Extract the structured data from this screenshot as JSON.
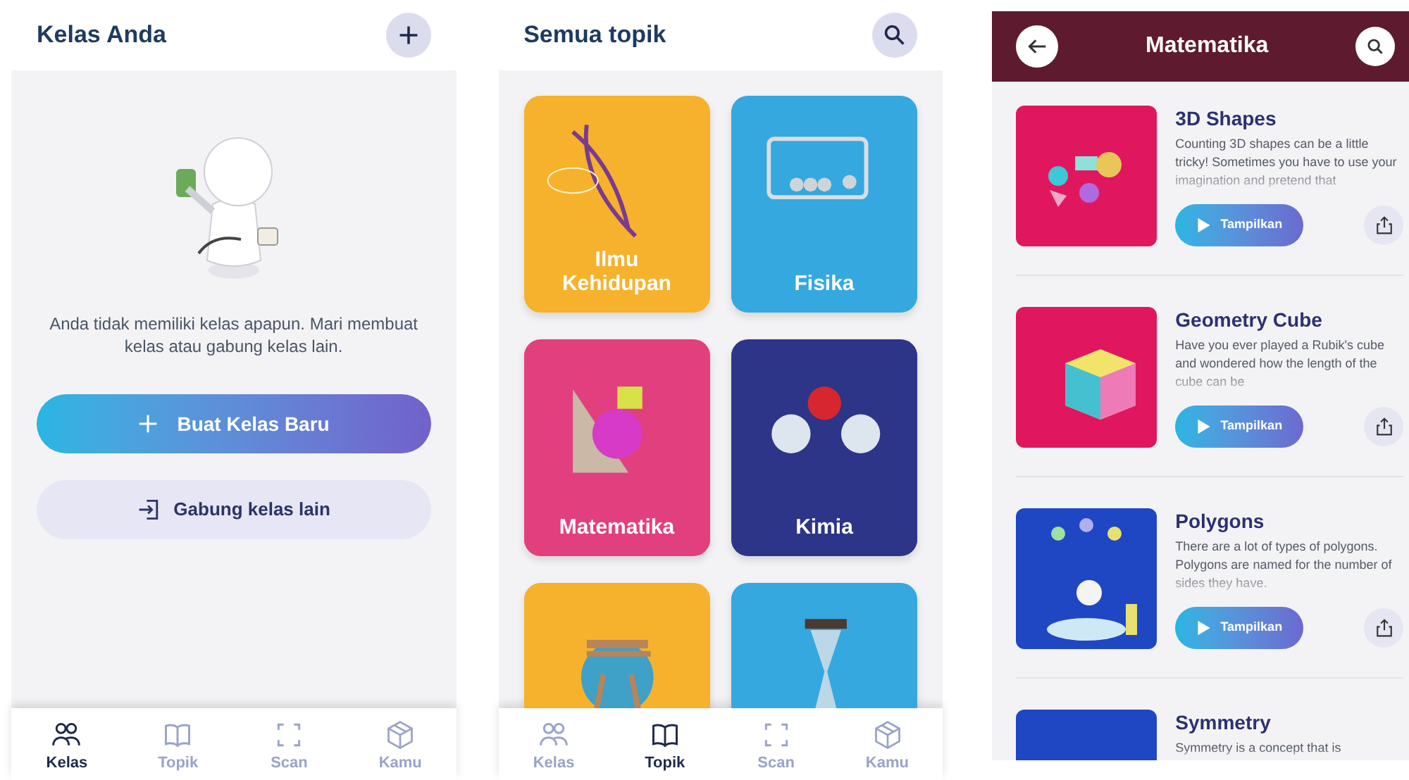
{
  "classes_screen": {
    "title": "Kelas Anda",
    "message": "Anda tidak memiliki kelas apapun. Mari membuat kelas atau gabung kelas lain.",
    "primary_button": "Buat Kelas Baru",
    "secondary_button": "Gabung kelas lain",
    "nav": [
      {
        "label": "Kelas",
        "selected": true
      },
      {
        "label": "Topik",
        "selected": false
      },
      {
        "label": "Scan",
        "selected": false
      },
      {
        "label": "Kamu",
        "selected": false
      }
    ]
  },
  "topics_screen": {
    "title": "Semua topik",
    "topics": [
      {
        "label": "Ilmu Kehidupan",
        "color": "#f6b22c"
      },
      {
        "label": "Fisika",
        "color": "#35a8df"
      },
      {
        "label": "Matematika",
        "color": "#e23f7e"
      },
      {
        "label": "Kimia",
        "color": "#2c3587"
      },
      {
        "color": "#f6b22c"
      },
      {
        "color": "#35a8df"
      }
    ],
    "nav": [
      {
        "label": "Kelas",
        "selected": false
      },
      {
        "label": "Topik",
        "selected": true
      },
      {
        "label": "Scan",
        "selected": false
      },
      {
        "label": "Kamu",
        "selected": false
      }
    ]
  },
  "topic_screen": {
    "title": "Matematika",
    "lessons": [
      {
        "title": "3D Shapes",
        "description": "Counting 3D shapes can be a little tricky! Sometimes you have to use your imagination and pretend that",
        "button": "Tampilkan",
        "color": "#e0175f"
      },
      {
        "title": "Geometry Cube",
        "description": "Have you ever played a Rubik's cube and wondered how the length of the cube can be",
        "button": "Tampilkan",
        "color": "#e0175f"
      },
      {
        "title": "Polygons",
        "description": "There are a lot of types of polygons. Polygons are named for the number of sides they have.",
        "button": "Tampilkan",
        "color": "#1f47c4"
      },
      {
        "title": "Symmetry",
        "description": "Symmetry is a concept that is",
        "color": "#1f47c4"
      }
    ]
  }
}
